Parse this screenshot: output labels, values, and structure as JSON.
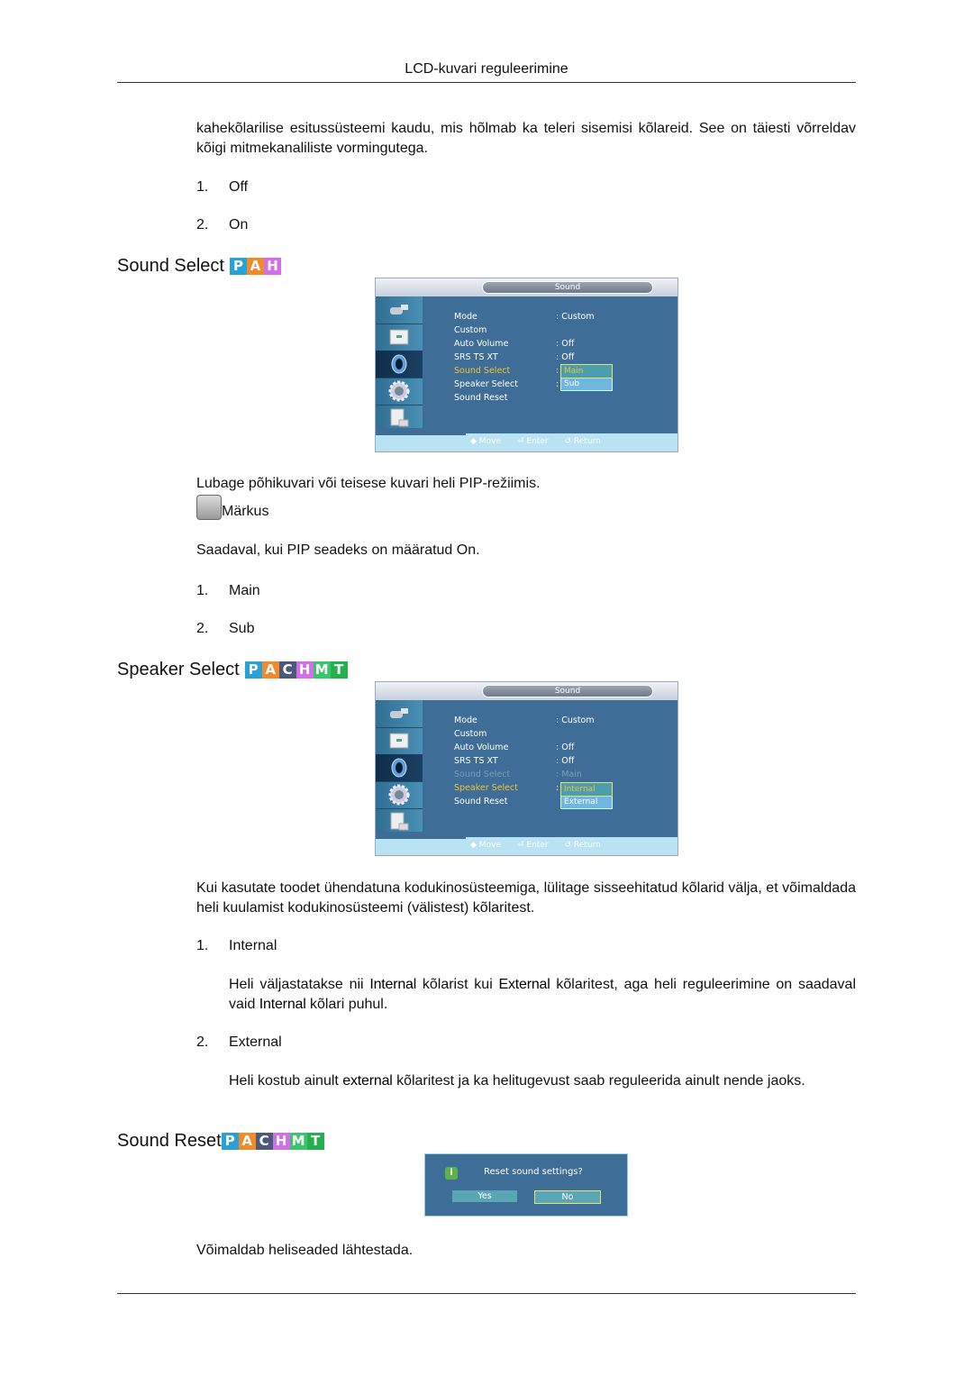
{
  "page": {
    "header_title": "LCD-kuvari reguleerimine"
  },
  "intro": {
    "text": "kahekõlarilise esitussüsteemi kaudu, mis hõlmab ka teleri sisemisi kõlareid. See on täiesti võrreldav kõigi mitmekanaliliste vormingutega.",
    "options": [
      {
        "num": "1.",
        "label": "Off"
      },
      {
        "num": "2.",
        "label": "On"
      }
    ]
  },
  "sound_select": {
    "title": "Sound Select",
    "badges": [
      {
        "letter": "P",
        "color": "#2aa1d6"
      },
      {
        "letter": "A",
        "color": "#f08a2a"
      },
      {
        "letter": "H",
        "color": "#d46ee8"
      }
    ],
    "osd": {
      "title": "Sound",
      "rows": [
        {
          "key": "Mode",
          "value": ": Custom"
        },
        {
          "key": "Custom",
          "value": ""
        },
        {
          "key": "Auto Volume",
          "value": ": Off"
        },
        {
          "key": "SRS TS XT",
          "value": ": Off"
        },
        {
          "key": "Sound Select",
          "value": ":"
        },
        {
          "key": "Speaker Select",
          "value": ":"
        },
        {
          "key": "Sound Reset",
          "value": ""
        }
      ],
      "dropdown": [
        "Main",
        "Sub"
      ],
      "hints": [
        "Move",
        "Enter",
        "Return"
      ]
    },
    "description": "Lubage põhikuvari või teisese kuvari heli PIP-režiimis.",
    "note_label": "Märkus",
    "note_text": "Saadaval, kui PIP seadeks on määratud On.",
    "options": [
      {
        "num": "1.",
        "label": "Main"
      },
      {
        "num": "2.",
        "label": "Sub"
      }
    ]
  },
  "speaker_select": {
    "title": "Speaker Select",
    "badges": [
      {
        "letter": "P",
        "color": "#2aa1d6"
      },
      {
        "letter": "A",
        "color": "#f08a2a"
      },
      {
        "letter": "C",
        "color": "#4a5a78"
      },
      {
        "letter": "H",
        "color": "#d46ee8"
      },
      {
        "letter": "M",
        "color": "#3cc46a"
      },
      {
        "letter": "T",
        "color": "#24b04e"
      }
    ],
    "osd": {
      "title": "Sound",
      "rows": [
        {
          "key": "Mode",
          "value": ": Custom"
        },
        {
          "key": "Custom",
          "value": ""
        },
        {
          "key": "Auto Volume",
          "value": ": Off"
        },
        {
          "key": "SRS TS XT",
          "value": ": Off"
        },
        {
          "key": "Sound Select",
          "value": ": Main"
        },
        {
          "key": "Speaker Select",
          "value": ":"
        },
        {
          "key": "Sound Reset",
          "value": ""
        }
      ],
      "dropdown": [
        "Internal",
        "External"
      ],
      "hints": [
        "Move",
        "Enter",
        "Return"
      ]
    },
    "description": "Kui kasutate toodet ühendatuna kodukinosüsteemiga, lülitage sisseehitatud kõlarid välja, et võimaldada heli kuulamist kodukinosüsteemi (välistest) kõlaritest.",
    "options": [
      {
        "num": "1.",
        "label": "Internal",
        "desc_parts": [
          "Heli väljastatakse nii ",
          "Internal",
          " kõlarist kui ",
          "External",
          " kõlaritest, aga heli reguleerimine on saadaval vaid ",
          "Internal",
          " kõlari puhul."
        ]
      },
      {
        "num": "2.",
        "label": "External",
        "desc_parts": [
          "Heli kostub ainult ",
          "external",
          " kõlaritest ja ka helitugevust saab reguleerida ainult nende jaoks."
        ]
      }
    ]
  },
  "sound_reset": {
    "title": "Sound Reset",
    "badges": [
      {
        "letter": "P",
        "color": "#2aa1d6"
      },
      {
        "letter": "A",
        "color": "#f08a2a"
      },
      {
        "letter": "C",
        "color": "#4a5a78"
      },
      {
        "letter": "H",
        "color": "#d46ee8"
      },
      {
        "letter": "M",
        "color": "#3cc46a"
      },
      {
        "letter": "T",
        "color": "#24b04e"
      }
    ],
    "dialog": {
      "question": "Reset sound settings?",
      "yes": "Yes",
      "no": "No",
      "icon": "info-icon"
    },
    "description": "Võimaldab heliseaded lähtestada."
  }
}
